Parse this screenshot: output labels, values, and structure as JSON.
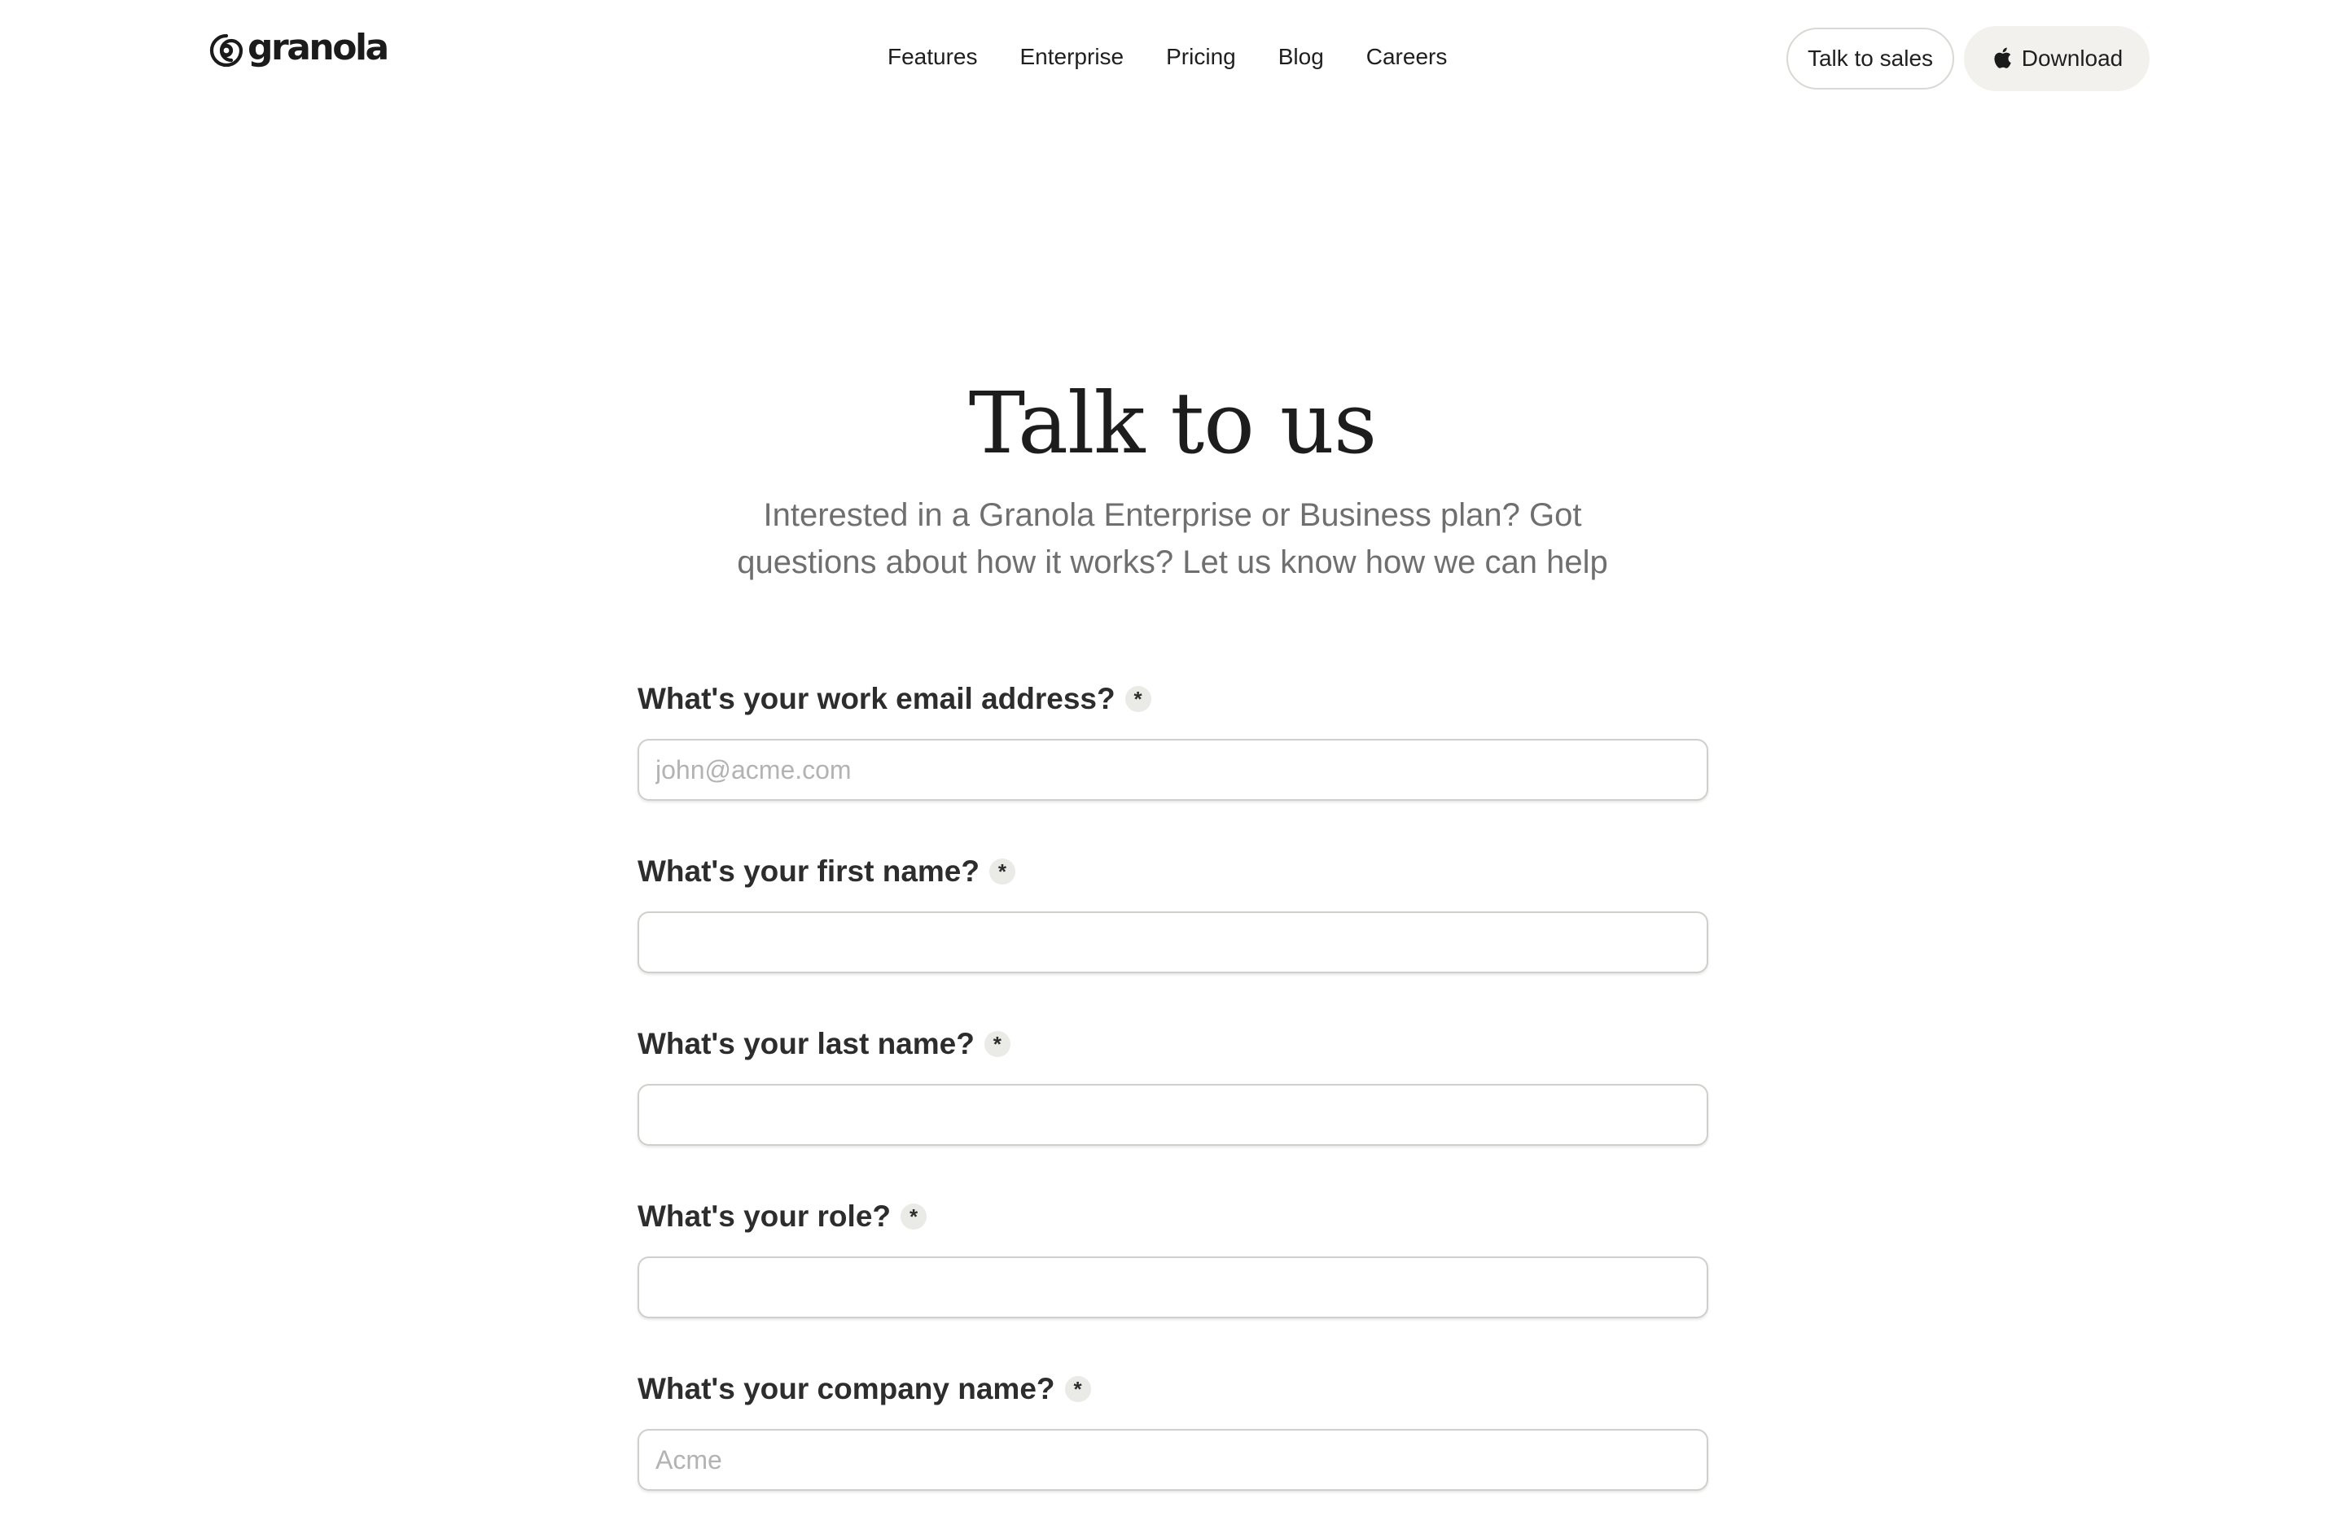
{
  "brand": {
    "name": "granola",
    "logo_icon": "granola-spiral-icon"
  },
  "nav": {
    "links": [
      "Features",
      "Enterprise",
      "Pricing",
      "Blog",
      "Careers"
    ],
    "talk_to_sales": "Talk to sales",
    "download": "Download",
    "download_icon": "apple-icon"
  },
  "hero": {
    "title": "Talk to us",
    "subtitle": "Interested in a Granola Enterprise or Business plan? Got questions about how it works? Let us know how we can help"
  },
  "form": {
    "required_marker": "*",
    "fields": [
      {
        "label": "What's your work email address?",
        "placeholder": "john@acme.com",
        "value": ""
      },
      {
        "label": "What's your first name?",
        "placeholder": "",
        "value": ""
      },
      {
        "label": "What's your last name?",
        "placeholder": "",
        "value": ""
      },
      {
        "label": "What's your role?",
        "placeholder": "",
        "value": ""
      },
      {
        "label": "What's your company name?",
        "placeholder": "Acme",
        "value": ""
      }
    ]
  },
  "colors": {
    "text": "#1f1f1f",
    "subtitle": "#6f6f6f",
    "download_bg": "#f2f1ed",
    "input_border": "#cfcfcb",
    "placeholder": "#b3b3b3"
  }
}
